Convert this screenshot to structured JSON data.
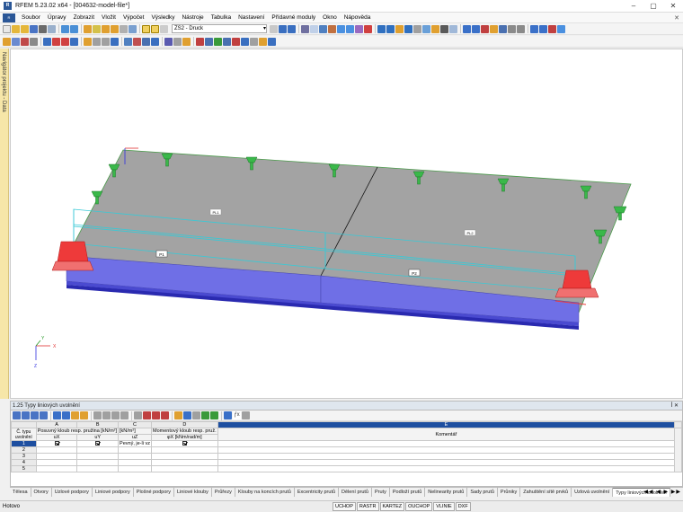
{
  "window": {
    "title": "RFEM 5.23.02 x64 - [004632-model-file*]",
    "controls": [
      "–",
      "▢",
      "✕"
    ]
  },
  "menu": {
    "items": [
      "Soubor",
      "Úpravy",
      "Zobrazit",
      "Vložit",
      "Výpočet",
      "Výsledky",
      "Nástroje",
      "Tabulka",
      "Nastavení",
      "Přídavné moduly",
      "Okno",
      "Nápověda"
    ],
    "close": "✕"
  },
  "toolbar": {
    "loadcase": "ZS2 - Druck"
  },
  "navigator": {
    "label": "Navigátor projektu - Data"
  },
  "model": {
    "labels": {
      "line1": "PL1",
      "line2": "PL2",
      "member1": "P1",
      "member2": "P2"
    },
    "axes": {
      "x": "X",
      "y": "Y",
      "z": "Z"
    },
    "colors": {
      "surface": "#a3a3a3",
      "member": "#6f6fe6",
      "support": "#ee3a3a",
      "release": "#3ab84a",
      "releaseLine": "#39c9d6"
    }
  },
  "panel": {
    "title": "1.25 Typy liniových uvolnění",
    "controls": "ꟾ ✕",
    "columns": [
      "A",
      "B",
      "C",
      "D",
      "E"
    ],
    "header": {
      "rowno": "Č. typu uvolnění",
      "a": "Posuvný kloub resp. pružina [kN/m²]",
      "c": "[kN/m²]",
      "d": "Momentový kloub resp. pruž.",
      "e": "Komentář",
      "ux": "uX",
      "uy": "uY",
      "uz": "uZ",
      "phix": "φX [kNm/rad/m]"
    },
    "rows": [
      {
        "no": "1",
        "ux": true,
        "uy": true,
        "uz": "Pevný, je-li vz",
        "phix": true,
        "comment": ""
      },
      {
        "no": "2",
        "comment": ""
      },
      {
        "no": "3",
        "comment": ""
      },
      {
        "no": "4",
        "comment": ""
      },
      {
        "no": "5",
        "comment": ""
      }
    ]
  },
  "tabs": {
    "items": [
      "Tělesa",
      "Otvory",
      "Uzlové podpory",
      "Liniové podpory",
      "Plošné podpory",
      "Liniové klouby",
      "Průřezy",
      "Klouby na koncích prutů",
      "Excentricity prutů",
      "Dělení prutů",
      "Pruty",
      "Podloží prutů",
      "Nelinearity prutů",
      "Sady prutů",
      "Průniky",
      "Zahuštění sítě prvků",
      "Uzlová uvolnění",
      "Typy liniových uvolnění"
    ],
    "nav": "◀◀ ◀ ▶ ▶▶"
  },
  "status": {
    "text": "Hotovo",
    "buttons": [
      "UCHOP",
      "RASTR",
      "KARTEZ",
      "OUCHOP",
      "VLINIE",
      "DXF"
    ]
  }
}
